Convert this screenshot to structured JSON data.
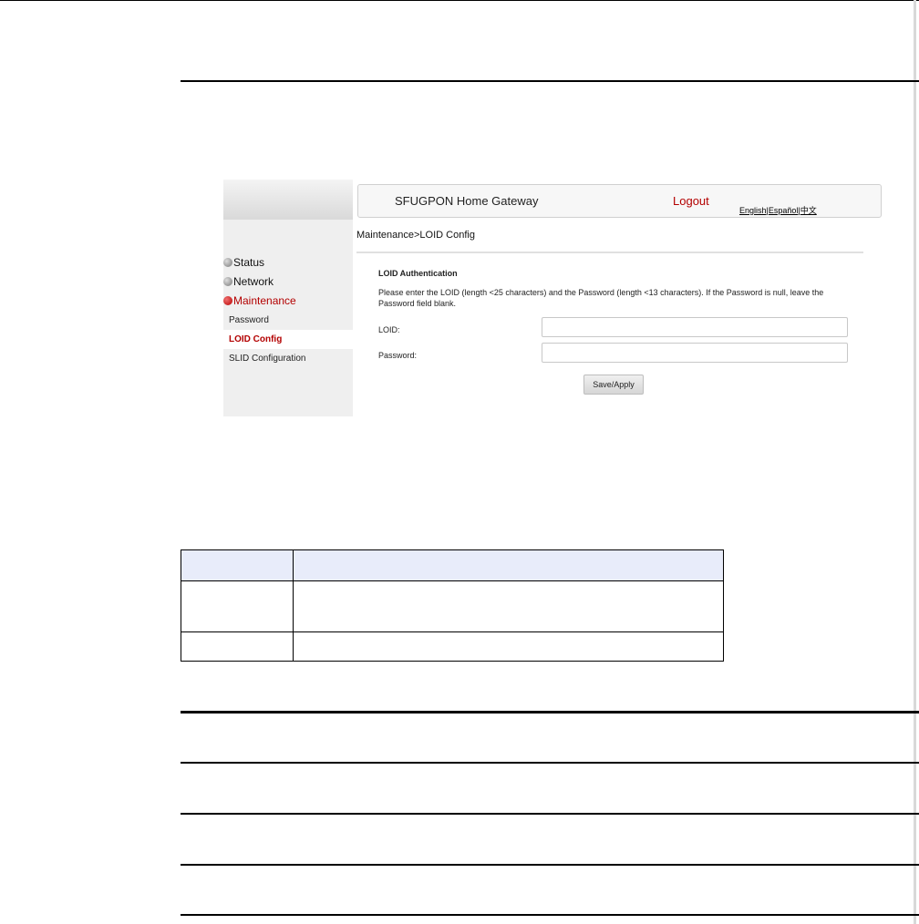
{
  "app": {
    "brand": "SFUGPON Home Gateway",
    "logout": "Logout",
    "languages": [
      "English",
      "Español",
      "中文"
    ],
    "language_separator": "|"
  },
  "sidebar": {
    "menu": [
      {
        "label": "Status",
        "state": "collapsed"
      },
      {
        "label": "Network",
        "state": "collapsed"
      },
      {
        "label": "Maintenance",
        "state": "expanded"
      }
    ],
    "submenu": [
      {
        "label": "Password",
        "active": false
      },
      {
        "label": "LOID Config",
        "active": true
      },
      {
        "label": "SLID Configuration",
        "active": false
      }
    ]
  },
  "main": {
    "breadcrumb": "Maintenance>LOID Config",
    "section_title": "LOID Authentication",
    "instructions": "Please enter the LOID (length <25 characters) and the Password (length <13 characters). If the Password is null, leave the Password field blank.",
    "fields": [
      {
        "label": "LOID:",
        "value": ""
      },
      {
        "label": "Password:",
        "value": ""
      }
    ],
    "save_button": "Save/Apply"
  },
  "colors": {
    "accent_red": "#b30000",
    "table_header": "#e8ecfa"
  }
}
